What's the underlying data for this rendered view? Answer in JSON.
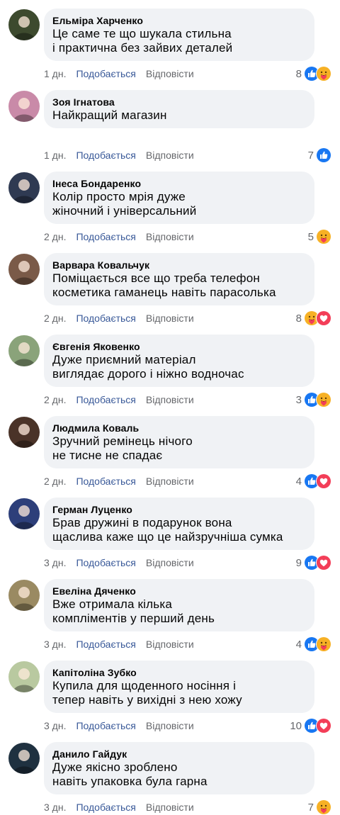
{
  "actions": {
    "like": "Подобається",
    "reply": "Відповісти"
  },
  "colors": {
    "bubble": "#f0f2f5",
    "link": "#385898",
    "muted": "#65676b",
    "like_blue": "#1877f2",
    "love_red": "#f33e58",
    "care_yellow": "#f7b125"
  },
  "comments": [
    {
      "author": "Ельміра Харченко",
      "text": "Це саме те що шукала стильна\nі практична без зайвих деталей",
      "time": "1 дн.",
      "count": "8",
      "reactions": [
        "like-icon",
        "care-icon"
      ],
      "avatar_color": "#3d4a2e"
    },
    {
      "author": "Зоя Ігнатова",
      "text": "Найкращий магазин",
      "time": "1 дн.",
      "count": "7",
      "reactions": [
        "like-icon"
      ],
      "avatar_color": "#c98aa8"
    },
    {
      "author": "Інеса Бондаренко",
      "text": "Колір просто мрія дуже\nжіночний і універсальний",
      "time": "2 дн.",
      "count": "5",
      "reactions": [
        "care-icon"
      ],
      "avatar_color": "#2f3a52"
    },
    {
      "author": "Варвара Ковальчук",
      "text": "Поміщається все що треба телефон\nкосметика гаманець навіть парасолька",
      "time": "2 дн.",
      "count": "8",
      "reactions": [
        "care-icon",
        "love-icon"
      ],
      "avatar_color": "#7a5a48"
    },
    {
      "author": "Євгенія Яковенко",
      "text": "Дуже приємний матеріал\nвиглядає дорого і ніжно водночас",
      "time": "2 дн.",
      "count": "3",
      "reactions": [
        "like-icon",
        "care-icon"
      ],
      "avatar_color": "#8aa37a"
    },
    {
      "author": "Людмила Коваль",
      "text": "Зручний ремінець нічого\nне тисне не спадає",
      "time": "2 дн.",
      "count": "4",
      "reactions": [
        "like-icon",
        "love-icon"
      ],
      "avatar_color": "#4a3328"
    },
    {
      "author": "Герман Луценко",
      "text": "Брав дружині в подарунок вона\nщаслива каже що це найзручніша сумка",
      "time": "3 дн.",
      "count": "9",
      "reactions": [
        "like-icon",
        "love-icon"
      ],
      "avatar_color": "#2d3f7a"
    },
    {
      "author": "Евеліна Дяченко",
      "text": "Вже отримала кілька\nкомпліментів у перший день",
      "time": "3 дн.",
      "count": "4",
      "reactions": [
        "like-icon",
        "care-icon"
      ],
      "avatar_color": "#9a8a62"
    },
    {
      "author": "Капітоліна Зубко",
      "text": "Купила для щоденного носіння і\nтепер навіть у вихідні з нею хожу",
      "time": "3 дн.",
      "count": "10",
      "reactions": [
        "like-icon",
        "love-icon"
      ],
      "avatar_color": "#b9c9a0"
    },
    {
      "author": "Данило Гайдук",
      "text": "Дуже якісно зроблено\nнавіть упаковка була гарна",
      "time": "3 дн.",
      "count": "7",
      "reactions": [
        "care-icon"
      ],
      "avatar_color": "#1f3140"
    }
  ]
}
